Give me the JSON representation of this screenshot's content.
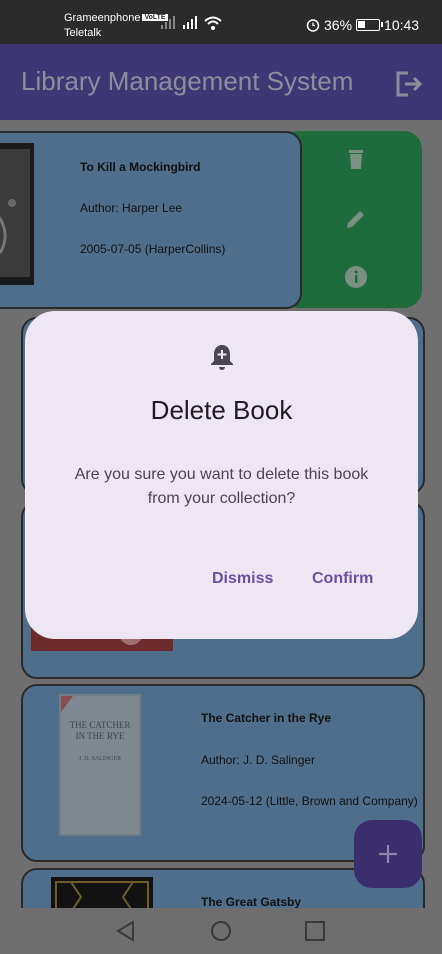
{
  "status_bar": {
    "carrier_primary": "Grameenphone",
    "volte": "VoLTE",
    "carrier_secondary": "Teletalk",
    "battery": "36%",
    "battery_level": 0.36,
    "time": "10:43"
  },
  "app_bar": {
    "title": "Library Management System",
    "logout_icon": "logout-icon"
  },
  "books": [
    {
      "title": "To Kill a Mockingbird",
      "author": "Author: Harper Lee",
      "published": "2005-07-05 (HarperCollins)"
    },
    {
      "title": "The Catcher in the Rye",
      "author": "Author: J. D. Salinger",
      "published": "2024-05-12 (Little, Brown and Company)",
      "cover_title": "THE CATCHER IN THE RYE",
      "cover_author": "J. D. SALINGER"
    },
    {
      "title": "The Great Gatsby"
    }
  ],
  "swipe_actions": [
    "delete-icon",
    "edit-icon",
    "info-icon"
  ],
  "dialog": {
    "icon": "notification-add-icon",
    "title": "Delete Book",
    "body": "Are you sure you want to delete this book from your collection?",
    "dismiss": "Dismiss",
    "confirm": "Confirm"
  },
  "fab": {
    "icon": "add-icon"
  },
  "nav": [
    "back-icon",
    "home-icon",
    "recents-icon"
  ],
  "colors": {
    "app_bar": "#3f3675",
    "card": "#4f6e8c",
    "swipe": "#1e6b3c",
    "dialog": "#efe6f4",
    "accent": "#6b4fa0"
  }
}
